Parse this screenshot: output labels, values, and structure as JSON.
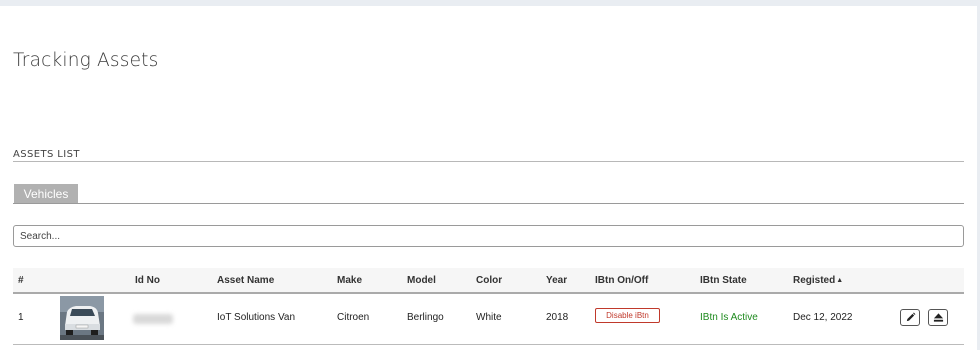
{
  "page": {
    "title": "Tracking Assets"
  },
  "section": {
    "title": "ASSETS LIST"
  },
  "tabs": [
    {
      "label": "Vehicles",
      "active": true
    }
  ],
  "search": {
    "placeholder": "Search...",
    "value": ""
  },
  "table": {
    "columns": [
      "#",
      "",
      "Id No",
      "Asset Name",
      "Make",
      "Model",
      "Color",
      "Year",
      "IBtn On/Off",
      "IBtn State",
      "Registed",
      ""
    ],
    "sort": {
      "column": "Registed",
      "direction": "ascending"
    },
    "rows": [
      {
        "index": "1",
        "image": "vehicle-photo",
        "id_no": "",
        "asset_name": "IoT Solutions Van",
        "make": "Citroen",
        "model": "Berlingo",
        "color": "White",
        "year": "2018",
        "ibtn_action": "Disable iBtn",
        "ibtn_state": "IBtn Is Active",
        "registered": "Dec 12, 2022",
        "actions": [
          "pencil-icon",
          "eject-icon"
        ]
      }
    ]
  },
  "colors": {
    "background": "#e9edf2",
    "tab": "#b1b1b1",
    "danger": "#c0392b",
    "success": "#1e8a1e"
  }
}
